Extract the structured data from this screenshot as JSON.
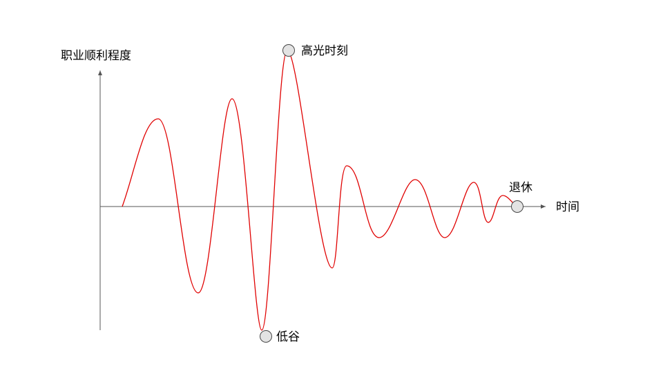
{
  "diagram": {
    "y_axis_label": "职业顺利程度",
    "x_axis_label": "时间",
    "peak_label": "高光时刻",
    "trough_label": "低谷",
    "end_label": "退休",
    "curve_color": "#e00000",
    "axis_color": "#555555",
    "marker_fill": "#e3e3e3"
  }
}
